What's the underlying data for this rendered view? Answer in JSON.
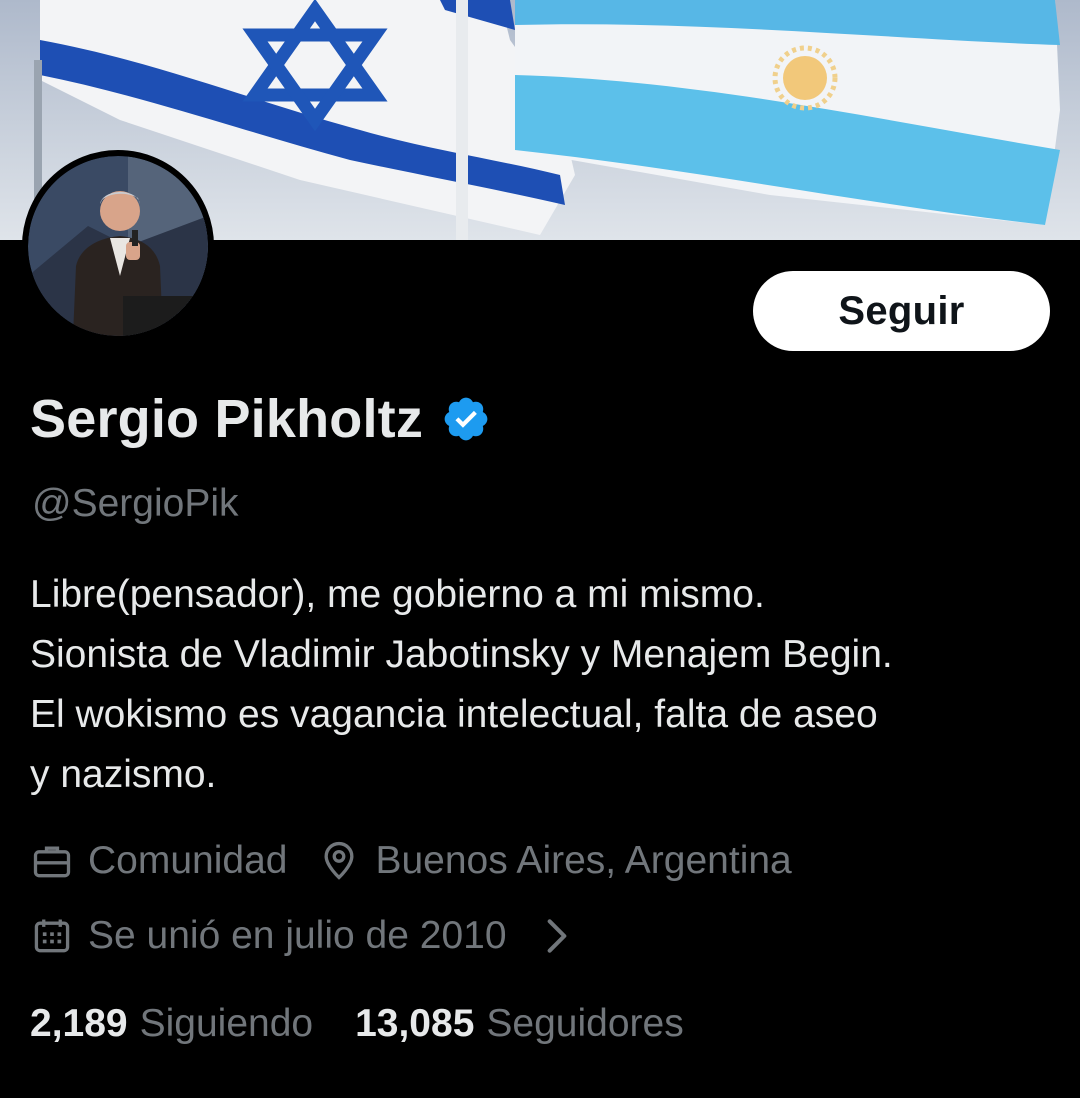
{
  "profile": {
    "name": "Sergio Pikholtz",
    "handle": "@SergioPik",
    "verified": true,
    "bio_lines": [
      "Libre(pensador), me gobierno a mi mismo.",
      "Sionista de Vladimir Jabotinsky y Menajem Begin.",
      "El wokismo es vagancia intelectual, falta de aseo",
      "y nazismo."
    ],
    "category": "Comunidad",
    "location": "Buenos Aires, Argentina",
    "joined": "Se unió en julio de 2010",
    "following_count": "2,189",
    "following_label": "Siguiendo",
    "followers_count": "13,085",
    "followers_label": "Seguidores"
  },
  "actions": {
    "follow_label": "Seguir"
  },
  "icons": {
    "category": "briefcase-icon",
    "location": "location-pin-icon",
    "joined": "calendar-icon",
    "joined_more": "chevron-right-icon",
    "verified": "verified-badge-icon"
  },
  "colors": {
    "background": "#000000",
    "text_primary": "#e7e9ea",
    "text_secondary": "#71767b",
    "verified_blue": "#1d9bf0",
    "button_bg": "#ffffff"
  }
}
